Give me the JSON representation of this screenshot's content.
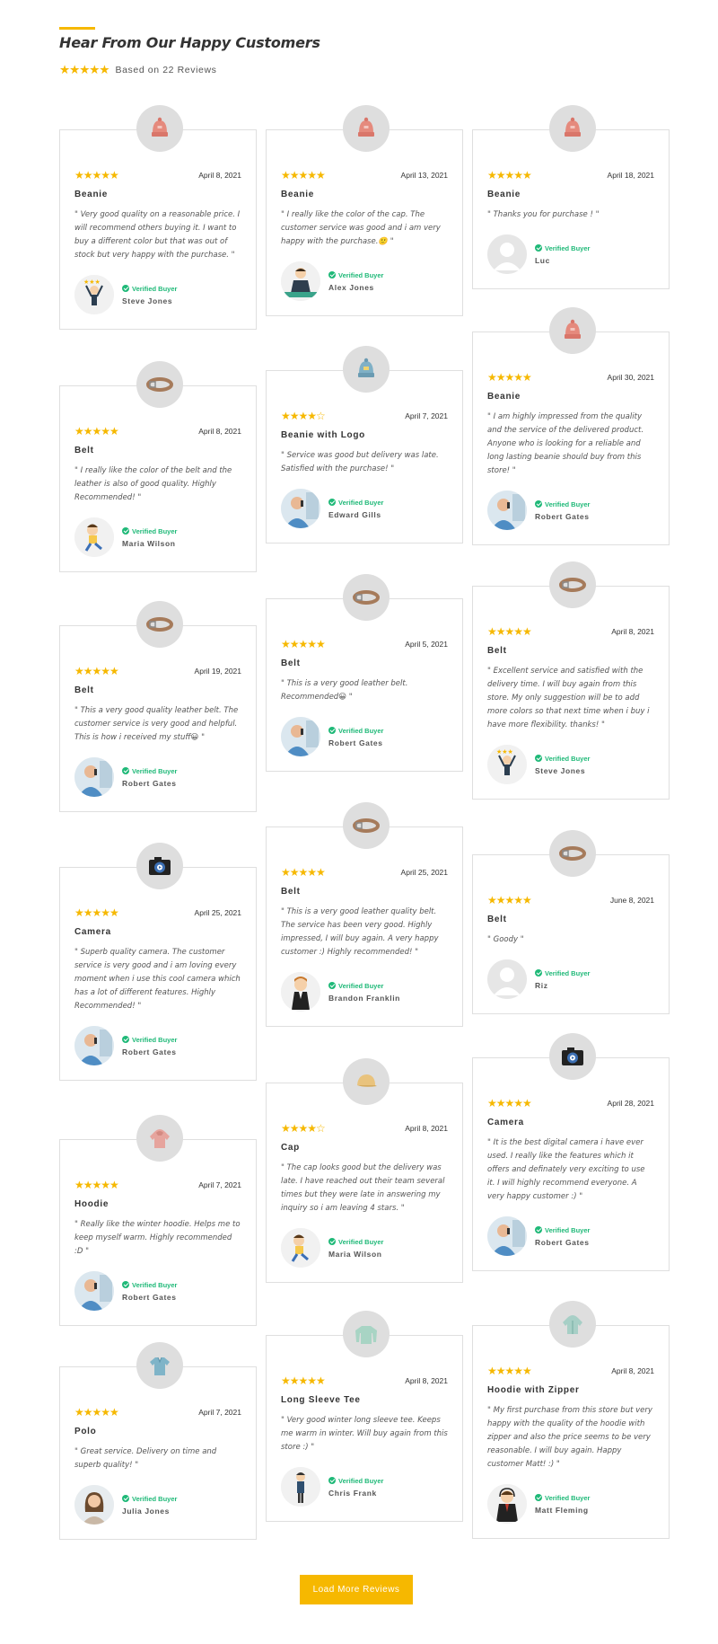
{
  "header": {
    "title": "Hear From Our Happy Customers",
    "stars": "★★★★★",
    "based_on": "Based on 22 Reviews"
  },
  "verified_label": "Verified Buyer",
  "colors": {
    "accent": "#f6b800",
    "verified": "#1fb978",
    "border": "#dfdfdf"
  },
  "columns": [
    [
      {
        "stars": "★★★★★",
        "date": "April 8, 2021",
        "product": "Beanie",
        "product_icon": "beanie-icon",
        "text": "\" Very good quality on a reasonable price. I will recommend others buying it. I want to buy a different color but that was out of stock but very happy with the purchase. \"",
        "reviewer": "Steve Jones",
        "avatar": "stars-man-avatar"
      },
      {
        "stars": "★★★★★",
        "date": "April 8, 2021",
        "product": "Belt",
        "product_icon": "belt-icon",
        "text": "\" I really like the color of the belt and the leather is also of good quality. Highly Recommended! \"",
        "reviewer": "Maria Wilson",
        "avatar": "jumping-kid-avatar"
      },
      {
        "stars": "★★★★★",
        "date": "April 19, 2021",
        "product": "Belt",
        "product_icon": "belt-icon",
        "text": "\" This a very good quality leather belt. The customer service is very good and helpful. This is how i received my stuff😀 \"",
        "reviewer": "Robert Gates",
        "avatar": "phone-man-avatar"
      },
      {
        "stars": "★★★★★",
        "date": "April 25, 2021",
        "product": "Camera",
        "product_icon": "camera-icon",
        "text": "\" Superb quality camera. The customer service is very good and i am loving every moment when i use this cool camera which has a lot of different features. Highly Recommended! \"",
        "reviewer": "Robert Gates",
        "avatar": "phone-man-avatar"
      },
      {
        "stars": "★★★★★",
        "date": "April 7, 2021",
        "product": "Hoodie",
        "product_icon": "hoodie-icon",
        "text": "\" Really like the winter hoodie. Helps me to keep myself warm. Highly recommended :D \"",
        "reviewer": "Robert Gates",
        "avatar": "phone-man-avatar"
      },
      {
        "stars": "★★★★★",
        "date": "April 7, 2021",
        "product": "Polo",
        "product_icon": "polo-icon",
        "text": "\" Great service. Delivery on time and superb quality! \"",
        "reviewer": "Julia Jones",
        "avatar": "woman-avatar"
      }
    ],
    [
      {
        "stars": "★★★★★",
        "date": "April 13, 2021",
        "product": "Beanie",
        "product_icon": "beanie-icon",
        "text": "\" I really like the color of the cap. The customer service was good and i am very happy with the purchase.🙂 \"",
        "reviewer": "Alex Jones",
        "avatar": "suit-man-avatar"
      },
      {
        "stars": "★★★★☆",
        "date": "April 7, 2021",
        "product": "Beanie with Logo",
        "product_icon": "beanie-logo-icon",
        "text": "\" Service was good but delivery was late. Satisfied with the purchase! \"",
        "reviewer": "Edward Gills",
        "avatar": "phone-man-avatar"
      },
      {
        "stars": "★★★★★",
        "date": "April 5, 2021",
        "product": "Belt",
        "product_icon": "belt-icon",
        "text": "\" This is a very good leather belt. Recommended😀 \"",
        "reviewer": "Robert Gates",
        "avatar": "phone-man-avatar"
      },
      {
        "stars": "★★★★★",
        "date": "April 25, 2021",
        "product": "Belt",
        "product_icon": "belt-icon",
        "text": "\" This is a very good leather quality belt. The service has been very good. Highly impressed, I will buy again. A very happy customer :) Highly recommended! \"",
        "reviewer": "Brandon Franklin",
        "avatar": "cartoon-man-avatar"
      },
      {
        "stars": "★★★★☆",
        "date": "April 8, 2021",
        "product": "Cap",
        "product_icon": "cap-icon",
        "text": "\" The cap looks good but the delivery was late. I have reached out their team several times but they were late in answering my inquiry so i am leaving 4 stars. \"",
        "reviewer": "Maria Wilson",
        "avatar": "jumping-kid-avatar"
      },
      {
        "stars": "★★★★★",
        "date": "April 8, 2021",
        "product": "Long Sleeve Tee",
        "product_icon": "long-sleeve-icon",
        "text": "\" Very good winter long sleeve tee. Keeps me warm in winter. Will buy again from this store :) \"",
        "reviewer": "Chris Frank",
        "avatar": "standing-man-avatar"
      }
    ],
    [
      {
        "stars": "★★★★★",
        "date": "April 18, 2021",
        "product": "Beanie",
        "product_icon": "beanie-icon",
        "text": "\" Thanks you for purchase ! \"",
        "reviewer": "Luc",
        "avatar": "default-avatar"
      },
      {
        "stars": "★★★★★",
        "date": "April 30, 2021",
        "product": "Beanie",
        "product_icon": "beanie-icon",
        "text": "\" I am highly impressed from the quality and the service of the delivered product. Anyone who is looking for a reliable and long lasting beanie should buy from this store! \"",
        "reviewer": "Robert Gates",
        "avatar": "phone-man-avatar"
      },
      {
        "stars": "★★★★★",
        "date": "April 8, 2021",
        "product": "Belt",
        "product_icon": "belt-icon",
        "text": "\" Excellent service and satisfied with the delivery time. I will buy again from this store. My only suggestion will be to add more colors so that next time when i buy i have more flexibility. thanks! \"",
        "reviewer": "Steve Jones",
        "avatar": "stars-man-avatar"
      },
      {
        "stars": "★★★★★",
        "date": "June 8, 2021",
        "product": "Belt",
        "product_icon": "belt-icon",
        "text": "\" Goody \"",
        "reviewer": "Riz",
        "avatar": "default-avatar"
      },
      {
        "stars": "★★★★★",
        "date": "April 28, 2021",
        "product": "Camera",
        "product_icon": "camera-icon",
        "text": "\" It is the best digital camera i have ever used. I really like the features which it offers and definately very exciting to use it. I will highly recommend everyone. A very happy customer :) \"",
        "reviewer": "Robert Gates",
        "avatar": "phone-man-avatar"
      },
      {
        "stars": "★★★★★",
        "date": "April 8, 2021",
        "product": "Hoodie with Zipper",
        "product_icon": "hoodie-zipper-icon",
        "text": "\" My first purchase from this store but very happy with the quality of the hoodie with zipper and also the price seems to be very reasonable. I will buy again. Happy customer Matt! :) \"",
        "reviewer": "Matt Fleming",
        "avatar": "headset-man-avatar"
      }
    ]
  ],
  "load_more": "Load More Reviews"
}
